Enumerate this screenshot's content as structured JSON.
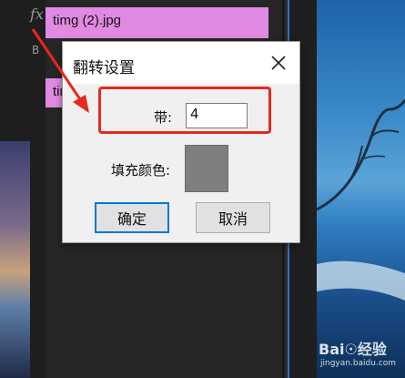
{
  "background": {
    "fx_label": "fx",
    "b_label": "B",
    "clip_1_name": "timg (2).jpg",
    "clip_2_name": "tim",
    "watermark": "Bai☉经验",
    "watermark_sub": "jingyan.baidu.com"
  },
  "dialog": {
    "title": "翻转设置",
    "band_label": "带:",
    "band_value": "4",
    "fill_color_label": "填充颜色:",
    "fill_color": "#7f7f7f",
    "ok_label": "确定",
    "cancel_label": "取消",
    "close_icon": "close-icon"
  },
  "colors": {
    "annotation_red": "#e8281e",
    "clip_pink": "#e08ae3",
    "timeline_dark": "#262626"
  }
}
